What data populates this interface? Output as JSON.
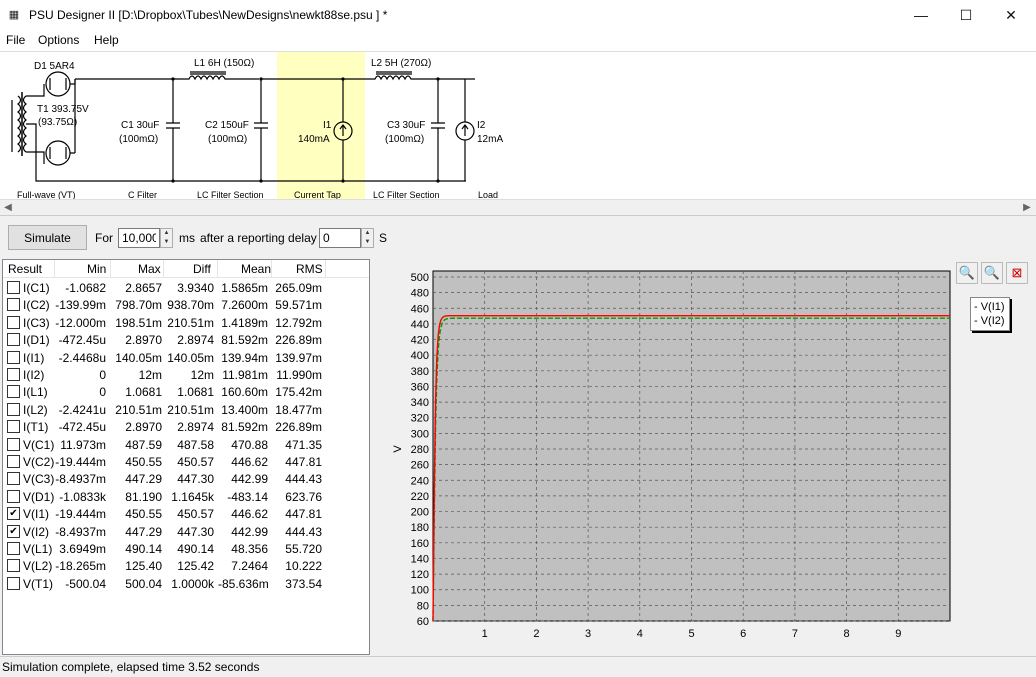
{
  "window": {
    "title": "PSU Designer II  [D:\\Dropbox\\Tubes\\NewDesigns\\newkt88se.psu ] *",
    "minimize_glyph": "—",
    "maximize_glyph": "☐",
    "close_glyph": "✕"
  },
  "menu": {
    "file": "File",
    "options": "Options",
    "help": "Help"
  },
  "schematic": {
    "d1": "D1 5AR4",
    "t1_line1": "T1 393.75V",
    "t1_line2": "(93.75Ω)",
    "l1": "L1 6H (150Ω)",
    "l2": "L2 5H (270Ω)",
    "c1_line1": "C1 30uF",
    "c1_line2": "(100mΩ)",
    "c2_line1": "C2 150uF",
    "c2_line2": "(100mΩ)",
    "i1_line1": "I1",
    "i1_line2": "140mA",
    "c3_line1": "C3 30uF",
    "c3_line2": "(100mΩ)",
    "i2_line1": "I2",
    "i2_line2": "12mA",
    "sections": [
      "Full-wave (VT)",
      "C Filter",
      "LC Filter Section",
      "Current Tap",
      "LC Filter Section",
      "Load"
    ],
    "highlight_color": "#ffffc0"
  },
  "controls": {
    "simulate": "Simulate",
    "for_label": "For",
    "duration": "10,000",
    "ms_label": "ms",
    "delay_label": "after a reporting delay of",
    "delay": "0",
    "s_label": "S"
  },
  "results": {
    "headers": [
      "Result",
      "Min",
      "Max",
      "Diff",
      "Mean",
      "RMS"
    ],
    "rows": [
      {
        "name": "I(C1)",
        "checked": false,
        "min": "-1.0682",
        "max": "2.8657",
        "diff": "3.9340",
        "mean": "1.5865m",
        "rms": "265.09m"
      },
      {
        "name": "I(C2)",
        "checked": false,
        "min": "-139.99m",
        "max": "798.70m",
        "diff": "938.70m",
        "mean": "7.2600m",
        "rms": "59.571m"
      },
      {
        "name": "I(C3)",
        "checked": false,
        "min": "-12.000m",
        "max": "198.51m",
        "diff": "210.51m",
        "mean": "1.4189m",
        "rms": "12.792m"
      },
      {
        "name": "I(D1)",
        "checked": false,
        "min": "-472.45u",
        "max": "2.8970",
        "diff": "2.8974",
        "mean": "81.592m",
        "rms": "226.89m"
      },
      {
        "name": "I(I1)",
        "checked": false,
        "min": "-2.4468u",
        "max": "140.05m",
        "diff": "140.05m",
        "mean": "139.94m",
        "rms": "139.97m"
      },
      {
        "name": "I(I2)",
        "checked": false,
        "min": "0",
        "max": "12m",
        "diff": "12m",
        "mean": "11.981m",
        "rms": "11.990m"
      },
      {
        "name": "I(L1)",
        "checked": false,
        "min": "0",
        "max": "1.0681",
        "diff": "1.0681",
        "mean": "160.60m",
        "rms": "175.42m"
      },
      {
        "name": "I(L2)",
        "checked": false,
        "min": "-2.4241u",
        "max": "210.51m",
        "diff": "210.51m",
        "mean": "13.400m",
        "rms": "18.477m"
      },
      {
        "name": "I(T1)",
        "checked": false,
        "min": "-472.45u",
        "max": "2.8970",
        "diff": "2.8974",
        "mean": "81.592m",
        "rms": "226.89m"
      },
      {
        "name": "V(C1)",
        "checked": false,
        "min": "11.973m",
        "max": "487.59",
        "diff": "487.58",
        "mean": "470.88",
        "rms": "471.35"
      },
      {
        "name": "V(C2)",
        "checked": false,
        "min": "-19.444m",
        "max": "450.55",
        "diff": "450.57",
        "mean": "446.62",
        "rms": "447.81"
      },
      {
        "name": "V(C3)",
        "checked": false,
        "min": "-8.4937m",
        "max": "447.29",
        "diff": "447.30",
        "mean": "442.99",
        "rms": "444.43"
      },
      {
        "name": "V(D1)",
        "checked": false,
        "min": "-1.0833k",
        "max": "81.190",
        "diff": "1.1645k",
        "mean": "-483.14",
        "rms": "623.76"
      },
      {
        "name": "V(I1)",
        "checked": true,
        "min": "-19.444m",
        "max": "450.55",
        "diff": "450.57",
        "mean": "446.62",
        "rms": "447.81"
      },
      {
        "name": "V(I2)",
        "checked": true,
        "min": "-8.4937m",
        "max": "447.29",
        "diff": "447.30",
        "mean": "442.99",
        "rms": "444.43"
      },
      {
        "name": "V(L1)",
        "checked": false,
        "min": "3.6949m",
        "max": "490.14",
        "diff": "490.14",
        "mean": "48.356",
        "rms": "55.720"
      },
      {
        "name": "V(L2)",
        "checked": false,
        "min": "-18.265m",
        "max": "125.40",
        "diff": "125.42",
        "mean": "7.2464",
        "rms": "10.222"
      },
      {
        "name": "V(T1)",
        "checked": false,
        "min": "-500.04",
        "max": "500.04",
        "diff": "1.0000k",
        "mean": "-85.636m",
        "rms": "373.54"
      }
    ]
  },
  "graph": {
    "zoom_in_icon": "zoom-in-icon",
    "zoom_fit_icon": "zoom-fit-icon",
    "zoom_reset_icon": "zoom-reset-icon",
    "legend": [
      "- V(I1)",
      "- V(I2)"
    ]
  },
  "chart_data": {
    "type": "line",
    "ylabel": "V",
    "xlim": [
      0,
      10
    ],
    "ylim": [
      60,
      500
    ],
    "xticks": [
      1,
      2,
      3,
      4,
      5,
      6,
      7,
      8,
      9
    ],
    "yticks": [
      60,
      80,
      100,
      120,
      140,
      160,
      180,
      200,
      220,
      240,
      260,
      280,
      300,
      320,
      340,
      360,
      380,
      400,
      420,
      440,
      460,
      480,
      500
    ],
    "grid": true,
    "legend_position": "top-right",
    "background": "#c0c0c0",
    "series": [
      {
        "name": "V(I1)",
        "color": "#ff0000",
        "steady": 450.55,
        "tau": 0.035
      },
      {
        "name": "V(I2)",
        "color": "#00a000",
        "steady": 447.29,
        "tau": 0.042
      }
    ]
  },
  "status": {
    "text": "Simulation complete, elapsed time 3.52 seconds"
  }
}
